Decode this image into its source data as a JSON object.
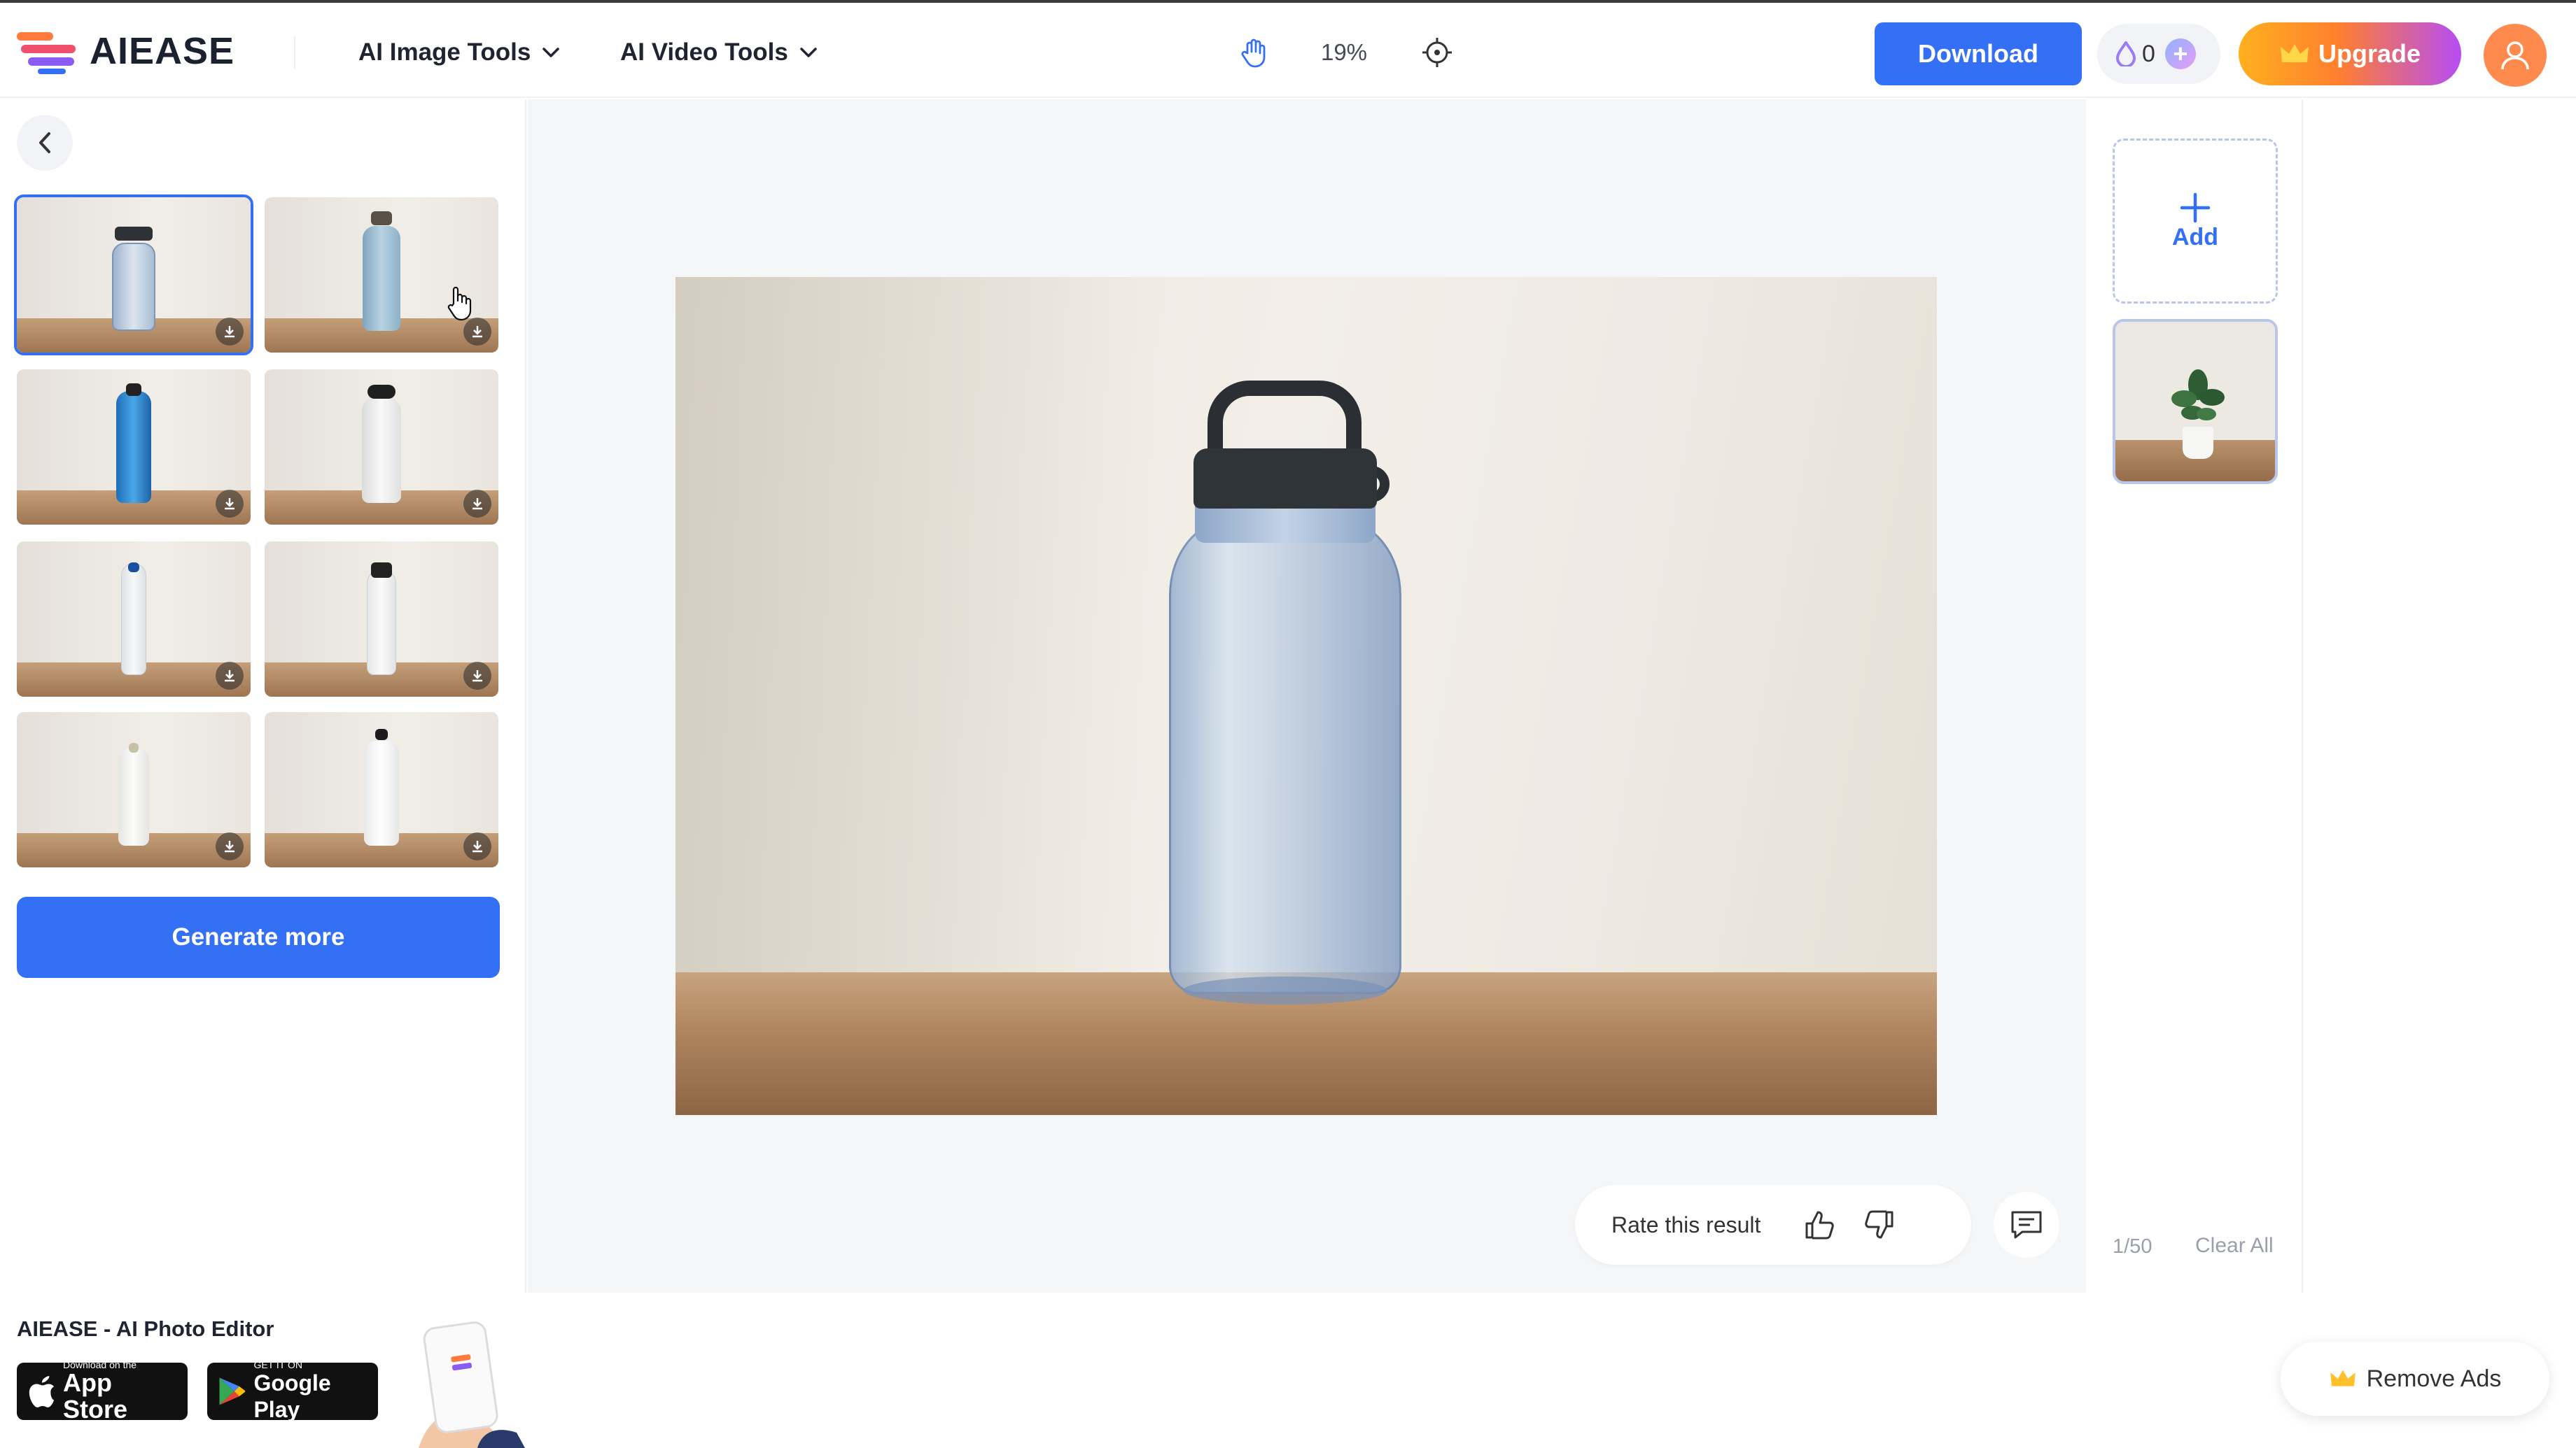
{
  "app": {
    "name": "AIEASE"
  },
  "nav": {
    "image_tools": "AI Image Tools",
    "video_tools": "AI Video Tools"
  },
  "toolbar": {
    "zoom": "19%",
    "download_label": "Download",
    "credits": "0",
    "upgrade_label": "Upgrade"
  },
  "left_panel": {
    "generate_more_label": "Generate more",
    "selected_index": 0,
    "thumbnails": [
      {
        "name": "clear-bottle-black-cap"
      },
      {
        "name": "light-blue-steel-bottle"
      },
      {
        "name": "blue-bottle-black-cap"
      },
      {
        "name": "white-bottle-black-cap"
      },
      {
        "name": "clear-slim-bottle-blue-cap"
      },
      {
        "name": "clear-bottle-logo"
      },
      {
        "name": "white-bottle-plain"
      },
      {
        "name": "white-bottle-dark-cap"
      }
    ]
  },
  "canvas": {
    "rate_label": "Rate this result"
  },
  "right_panel": {
    "add_label": "Add",
    "page_count": "1/50",
    "clear_all_label": "Clear All"
  },
  "bottom": {
    "app_title": "AIEASE - AI Photo Editor",
    "app_store": {
      "small": "Download on the",
      "big": "App Store"
    },
    "google_play": {
      "small": "GET IT ON",
      "big": "Google Play"
    },
    "remove_ads_label": "Remove Ads"
  },
  "colors": {
    "accent": "#3470f5",
    "upgrade_start": "#ffb01f",
    "upgrade_end": "#b54df5",
    "avatar": "#ff8a4d"
  }
}
